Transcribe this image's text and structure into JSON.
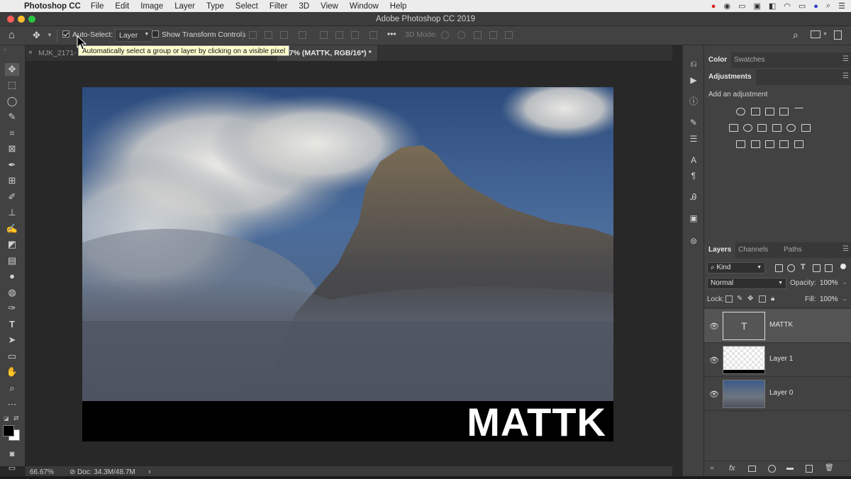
{
  "menubar": {
    "app_name": "Photoshop CC",
    "items": [
      "File",
      "Edit",
      "Image",
      "Layer",
      "Type",
      "Select",
      "Filter",
      "3D",
      "View",
      "Window",
      "Help"
    ]
  },
  "window": {
    "title": "Adobe Photoshop CC 2019"
  },
  "options": {
    "auto_select_label": "Auto-Select:",
    "auto_select_checked": true,
    "target_value": "Layer",
    "transform_controls_label": "Show Transform Controls",
    "transform_controls_checked": false,
    "mode_3d_label": "3D Mode:",
    "more_label": "•••"
  },
  "tooltip": {
    "text": "Automatically select a group or layer by clicking on a visible pixel"
  },
  "tabs": [
    {
      "label": "MJK_2171-",
      "active": false
    },
    {
      "label": "6.7% (MATTK, RGB/16*) *",
      "active": true
    }
  ],
  "canvas": {
    "overlay_text": "MATTK"
  },
  "status": {
    "zoom": "66.67%",
    "doc": "Doc: 34.3M/48.7M"
  },
  "color_panel": {
    "tabs": [
      "Color",
      "Swatches"
    ],
    "active_tab": "Color"
  },
  "adjustments_panel": {
    "title": "Adjustments",
    "hint": "Add an adjustment"
  },
  "layers_panel": {
    "tabs": [
      "Layers",
      "Channels",
      "Paths"
    ],
    "active_tab": "Layers",
    "filter_kind": "Kind",
    "blend_mode": "Normal",
    "opacity_label": "Opacity:",
    "opacity_value": "100%",
    "lock_label": "Lock:",
    "fill_label": "Fill:",
    "fill_value": "100%",
    "layers": [
      {
        "name": "MATTK",
        "type": "text",
        "selected": true
      },
      {
        "name": "Layer 1",
        "type": "pixel",
        "selected": false
      },
      {
        "name": "Layer 0",
        "type": "image",
        "selected": false
      }
    ],
    "footer_fx": "fx"
  }
}
